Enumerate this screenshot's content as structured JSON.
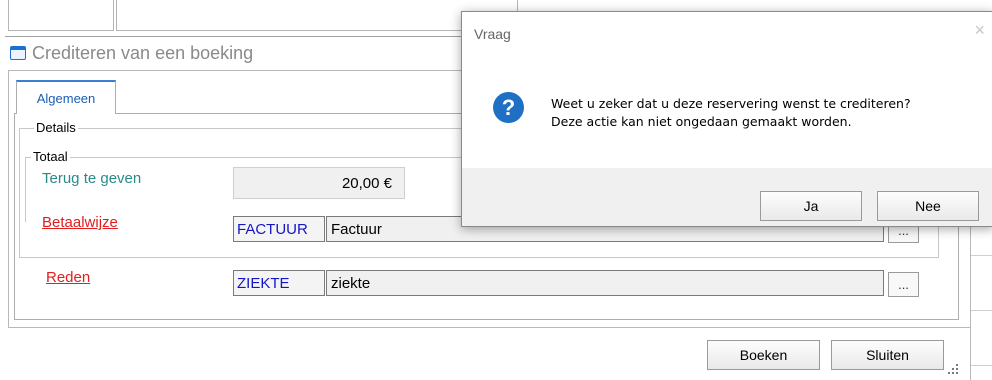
{
  "dialog": {
    "title": "Vraag",
    "close_glyph": "×",
    "icon": "question-icon",
    "icon_glyph": "?",
    "message_line1": "Weet u zeker dat u deze reservering wenst te crediteren?",
    "message_line2": "Deze actie kan niet ongedaan gemaakt worden.",
    "yes_label": "Ja",
    "no_label": "Nee"
  },
  "window": {
    "title": "Crediteren van een boeking",
    "icon": "window-icon"
  },
  "tabs": [
    {
      "label": "Algemeen"
    }
  ],
  "details": {
    "legend": "Details",
    "totaal": {
      "legend": "Totaal",
      "label": "Terug te geven",
      "value": "20,00 €"
    },
    "betaalwijze": {
      "label": "Betaalwijze",
      "code": "FACTUUR",
      "description": "Factuur",
      "lookup_label": "..."
    }
  },
  "reden": {
    "label": "Reden",
    "code": "ZIEKTE",
    "description": "ziekte",
    "lookup_label": "..."
  },
  "buttons": {
    "book_label": "Boeken",
    "close_label": "Sluiten"
  },
  "colors": {
    "accent": "#1f6fc5",
    "teal_label": "#2a8a8a",
    "link_red": "#e02020",
    "code_blue": "#1515c8"
  }
}
